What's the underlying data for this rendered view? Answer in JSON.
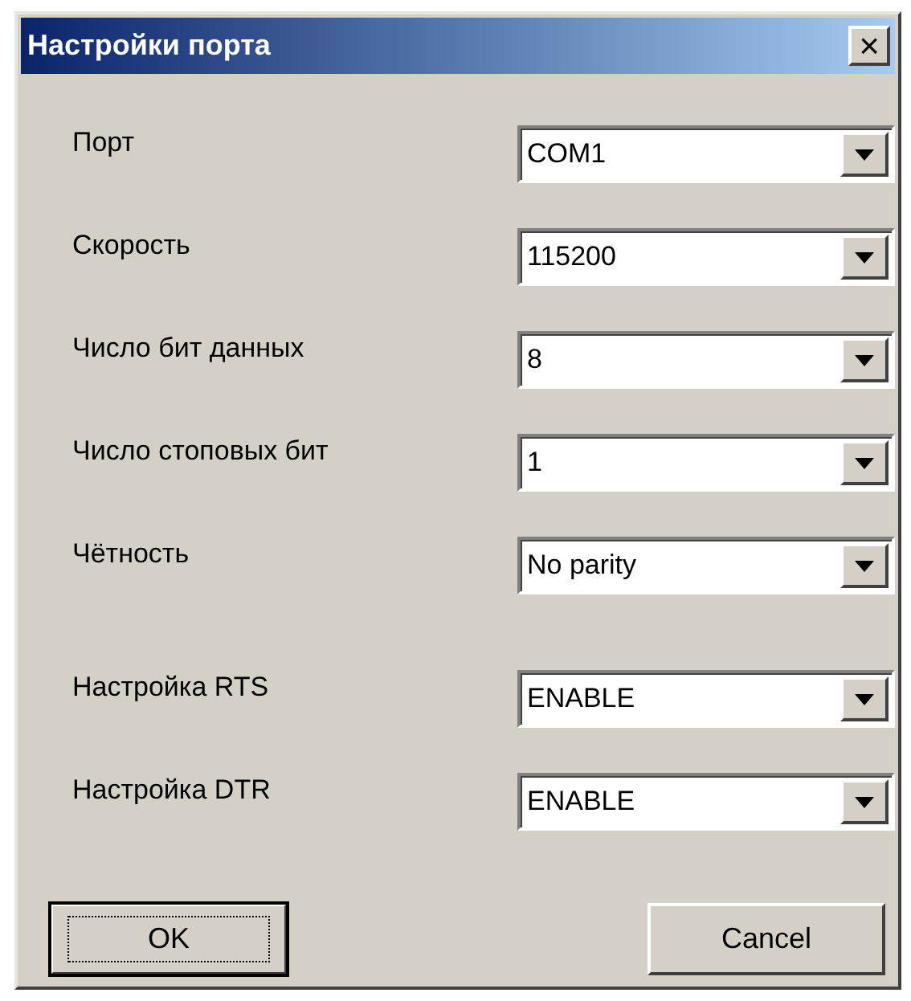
{
  "window": {
    "title": "Настройки порта",
    "close": "×"
  },
  "groups": [
    {
      "fields": [
        {
          "label": "Порт",
          "value": "COM1"
        },
        {
          "label": "Скорость",
          "value": "115200"
        },
        {
          "label": "Число бит данных",
          "value": "8"
        },
        {
          "label": "Число стоповых бит",
          "value": "1"
        },
        {
          "label": "Чётность",
          "value": "No parity"
        }
      ]
    },
    {
      "fields": [
        {
          "label": "Настройка RTS",
          "value": "ENABLE"
        },
        {
          "label": "Настройка DTR",
          "value": "ENABLE"
        }
      ]
    }
  ],
  "buttons": [
    {
      "label": "OK",
      "default": true
    },
    {
      "label": "Cancel",
      "default": false
    }
  ]
}
